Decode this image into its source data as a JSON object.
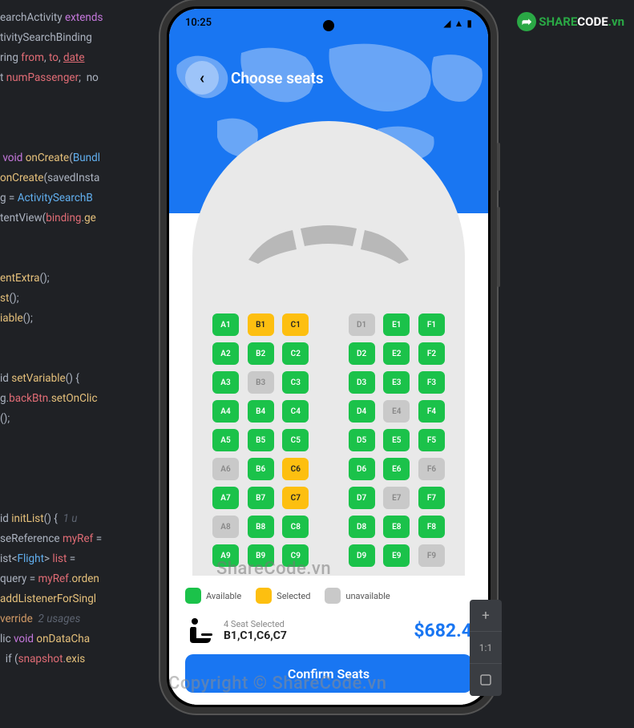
{
  "status": {
    "time": "10:25"
  },
  "header": {
    "title": "Choose seats"
  },
  "seats": [
    [
      {
        "l": "A1",
        "s": "avail"
      },
      {
        "l": "B1",
        "s": "sel"
      },
      {
        "l": "C1",
        "s": "sel"
      },
      null,
      {
        "l": "D1",
        "s": "unav"
      },
      {
        "l": "E1",
        "s": "avail"
      },
      {
        "l": "F1",
        "s": "avail"
      }
    ],
    [
      {
        "l": "A2",
        "s": "avail"
      },
      {
        "l": "B2",
        "s": "avail"
      },
      {
        "l": "C2",
        "s": "avail"
      },
      null,
      {
        "l": "D2",
        "s": "avail"
      },
      {
        "l": "E2",
        "s": "avail"
      },
      {
        "l": "F2",
        "s": "avail"
      }
    ],
    [
      {
        "l": "A3",
        "s": "avail"
      },
      {
        "l": "B3",
        "s": "unav"
      },
      {
        "l": "C3",
        "s": "avail"
      },
      null,
      {
        "l": "D3",
        "s": "avail"
      },
      {
        "l": "E3",
        "s": "avail"
      },
      {
        "l": "F3",
        "s": "avail"
      }
    ],
    [
      {
        "l": "A4",
        "s": "avail"
      },
      {
        "l": "B4",
        "s": "avail"
      },
      {
        "l": "C4",
        "s": "avail"
      },
      null,
      {
        "l": "D4",
        "s": "avail"
      },
      {
        "l": "E4",
        "s": "unav"
      },
      {
        "l": "F4",
        "s": "avail"
      }
    ],
    [
      {
        "l": "A5",
        "s": "avail"
      },
      {
        "l": "B5",
        "s": "avail"
      },
      {
        "l": "C5",
        "s": "avail"
      },
      null,
      {
        "l": "D5",
        "s": "avail"
      },
      {
        "l": "E5",
        "s": "avail"
      },
      {
        "l": "F5",
        "s": "avail"
      }
    ],
    [
      {
        "l": "A6",
        "s": "unav"
      },
      {
        "l": "B6",
        "s": "avail"
      },
      {
        "l": "C6",
        "s": "sel"
      },
      null,
      {
        "l": "D6",
        "s": "avail"
      },
      {
        "l": "E6",
        "s": "avail"
      },
      {
        "l": "F6",
        "s": "unav"
      }
    ],
    [
      {
        "l": "A7",
        "s": "avail"
      },
      {
        "l": "B7",
        "s": "avail"
      },
      {
        "l": "C7",
        "s": "sel"
      },
      null,
      {
        "l": "D7",
        "s": "avail"
      },
      {
        "l": "E7",
        "s": "unav"
      },
      {
        "l": "F7",
        "s": "avail"
      }
    ],
    [
      {
        "l": "A8",
        "s": "unav"
      },
      {
        "l": "B8",
        "s": "avail"
      },
      {
        "l": "C8",
        "s": "avail"
      },
      null,
      {
        "l": "D8",
        "s": "avail"
      },
      {
        "l": "E8",
        "s": "avail"
      },
      {
        "l": "F8",
        "s": "avail"
      }
    ],
    [
      {
        "l": "A9",
        "s": "avail"
      },
      {
        "l": "B9",
        "s": "avail"
      },
      {
        "l": "C9",
        "s": "avail"
      },
      null,
      {
        "l": "D9",
        "s": "avail"
      },
      {
        "l": "E9",
        "s": "avail"
      },
      {
        "l": "F9",
        "s": "unav"
      }
    ]
  ],
  "legend": {
    "available": "Available",
    "selected": "Selected",
    "unavailable": "unavailable"
  },
  "summary": {
    "count_label": "4 Seat Selected",
    "seats_label": "B1,C1,C6,C7",
    "price": "$682.4"
  },
  "confirm_label": "Confirm Seats",
  "watermarks": {
    "w1": "ShareCode.vn",
    "w2": "Copyright © ShareCode.vn"
  },
  "logo": {
    "share": "SHARE",
    "code": "CODE",
    "tld": ".vn"
  },
  "tools": {
    "plus": "+",
    "ratio": "1:1"
  },
  "colors": {
    "avail": "#1bc24a",
    "sel": "#fdbf10",
    "unav": "#c9c9c9"
  },
  "code": {
    "l1": [
      "earchActivity ",
      "extends"
    ],
    "l2": [
      "tivitySearchBinding"
    ],
    "l3": [
      "ring ",
      "from",
      ", ",
      "to",
      ", ",
      "date"
    ],
    "l4": [
      "t ",
      "numPassenger",
      ";  no"
    ],
    "l5": [
      " void ",
      "onCreate",
      "(",
      "Bundl"
    ],
    "l6": [
      "onCreate",
      "(",
      "savedInsta"
    ],
    "l7": [
      "g = ",
      "ActivitySearchB"
    ],
    "l8": [
      "tentView(",
      "binding",
      ".",
      "ge"
    ],
    "l9": [
      "entExtra",
      "();"
    ],
    "l10": [
      "st",
      "();"
    ],
    "l11": [
      "iable",
      "();"
    ],
    "l12": [
      "id ",
      "setVariable",
      "() {"
    ],
    "l13": [
      "g.",
      "backBtn",
      ".",
      "setOnClic"
    ],
    "l14": [
      "();"
    ],
    "l15": [
      "id ",
      "initList",
      "() {  ",
      "1 u"
    ],
    "l16": [
      "seReference ",
      "myRef",
      " ="
    ],
    "l17": [
      "ist<",
      "Flight",
      "> ",
      "list",
      " ="
    ],
    "l18": [
      "query = ",
      "myRef",
      ".",
      "orden"
    ],
    "l19": [
      "addListenerForSingl"
    ],
    "l20": [
      "verride",
      "  ",
      "2 usages"
    ],
    "l21": [
      "lic ",
      "void ",
      "onDataCha"
    ],
    "l22": [
      "  if (",
      "snapshot",
      ".",
      "exis"
    ]
  }
}
